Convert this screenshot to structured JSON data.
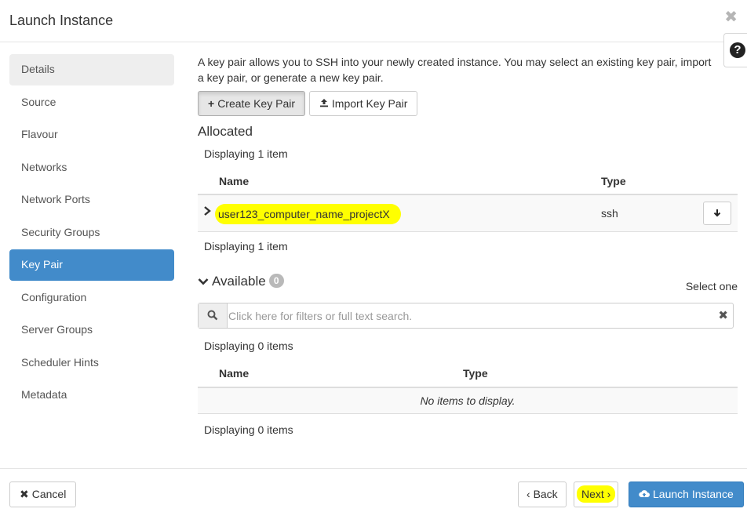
{
  "modal": {
    "title": "Launch Instance",
    "close_glyph": "✖",
    "help_glyph": "?"
  },
  "nav": {
    "items": [
      {
        "label": "Details"
      },
      {
        "label": "Source"
      },
      {
        "label": "Flavour"
      },
      {
        "label": "Networks"
      },
      {
        "label": "Network Ports"
      },
      {
        "label": "Security Groups"
      },
      {
        "label": "Key Pair"
      },
      {
        "label": "Configuration"
      },
      {
        "label": "Server Groups"
      },
      {
        "label": "Scheduler Hints"
      },
      {
        "label": "Metadata"
      }
    ],
    "active": "Key Pair"
  },
  "keypair": {
    "intro": "A key pair allows you to SSH into your newly created instance. You may select an existing key pair, import a key pair, or generate a new key pair.",
    "create_label": "Create Key Pair",
    "import_label": "Import Key Pair"
  },
  "allocated": {
    "heading": "Allocated",
    "count_top": "Displaying 1 item",
    "count_bottom": "Displaying 1 item",
    "columns": [
      "Name",
      "Type"
    ],
    "rows": [
      {
        "name": "user123_computer_name_projectX",
        "type": "ssh"
      }
    ]
  },
  "available": {
    "heading": "Available",
    "badge": "0",
    "select_hint": "Select one",
    "search_placeholder": "Click here for filters or full text search.",
    "count_top": "Displaying 0 items",
    "count_bottom": "Displaying 0 items",
    "columns": [
      "Name",
      "Type"
    ],
    "empty_message": "No items to display."
  },
  "footer": {
    "cancel_label": "Cancel",
    "back_label": "Back",
    "next_label": "Next",
    "launch_label": "Launch Instance"
  },
  "colors": {
    "primary": "#428bca",
    "highlight": "#ffff00",
    "nav_active_text": "#ffffff"
  },
  "icons": {
    "plus": "plus-icon",
    "upload": "upload-icon",
    "chevron_right": "chevron-right-icon",
    "chevron_down": "chevron-down-icon",
    "arrow_down": "arrow-down-icon",
    "search": "search-icon",
    "clear": "clear-icon",
    "cancel": "times-icon",
    "back": "chevron-left-icon",
    "next": "chevron-right-icon",
    "cloud_upload": "cloud-upload-icon"
  }
}
